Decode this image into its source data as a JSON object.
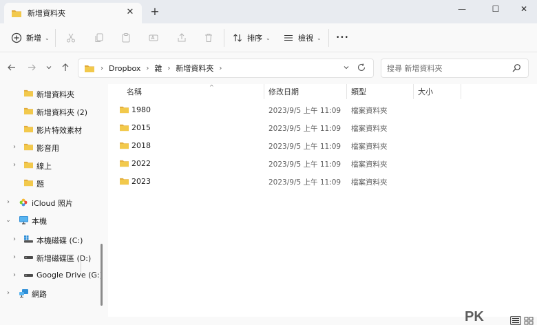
{
  "window": {
    "tab_title": "新增資料夾",
    "tab_close": "✕",
    "new_tab": "+",
    "min": "—",
    "max": "☐",
    "close": "✕"
  },
  "toolbar": {
    "new_label": "新增",
    "sort_label": "排序",
    "view_label": "檢視",
    "more": "•••"
  },
  "address": {
    "crumbs": [
      "Dropbox",
      "雜",
      "新增資料夾"
    ],
    "search_placeholder": "搜尋 新增資料夾"
  },
  "nav": {
    "items": [
      {
        "label": "新增資料夾"
      },
      {
        "label": "新增資料夾 (2)"
      },
      {
        "label": "影片特效素材"
      },
      {
        "label": "影音用"
      },
      {
        "label": "線上"
      },
      {
        "label": "題"
      },
      {
        "label": "iCloud 照片"
      },
      {
        "label": "本機"
      },
      {
        "label": "本機磁碟 (C:)"
      },
      {
        "label": "新增磁碟區 (D:)"
      },
      {
        "label": "Google Drive (G:)"
      },
      {
        "label": "網路"
      }
    ]
  },
  "columns": {
    "name": "名稱",
    "modified": "修改日期",
    "type": "類型",
    "size": "大小"
  },
  "files": [
    {
      "name": "1980",
      "date": "2023/9/5 上午 11:09",
      "type": "檔案資料夾"
    },
    {
      "name": "2015",
      "date": "2023/9/5 上午 11:09",
      "type": "檔案資料夾"
    },
    {
      "name": "2018",
      "date": "2023/9/5 上午 11:09",
      "type": "檔案資料夾"
    },
    {
      "name": "2022",
      "date": "2023/9/5 上午 11:09",
      "type": "檔案資料夾"
    },
    {
      "name": "2023",
      "date": "2023/9/5 上午 11:09",
      "type": "檔案資料夾"
    }
  ],
  "watermark": "PK",
  "colors": {
    "folder": "#f2c94c",
    "folder_dark": "#e0a83a"
  }
}
